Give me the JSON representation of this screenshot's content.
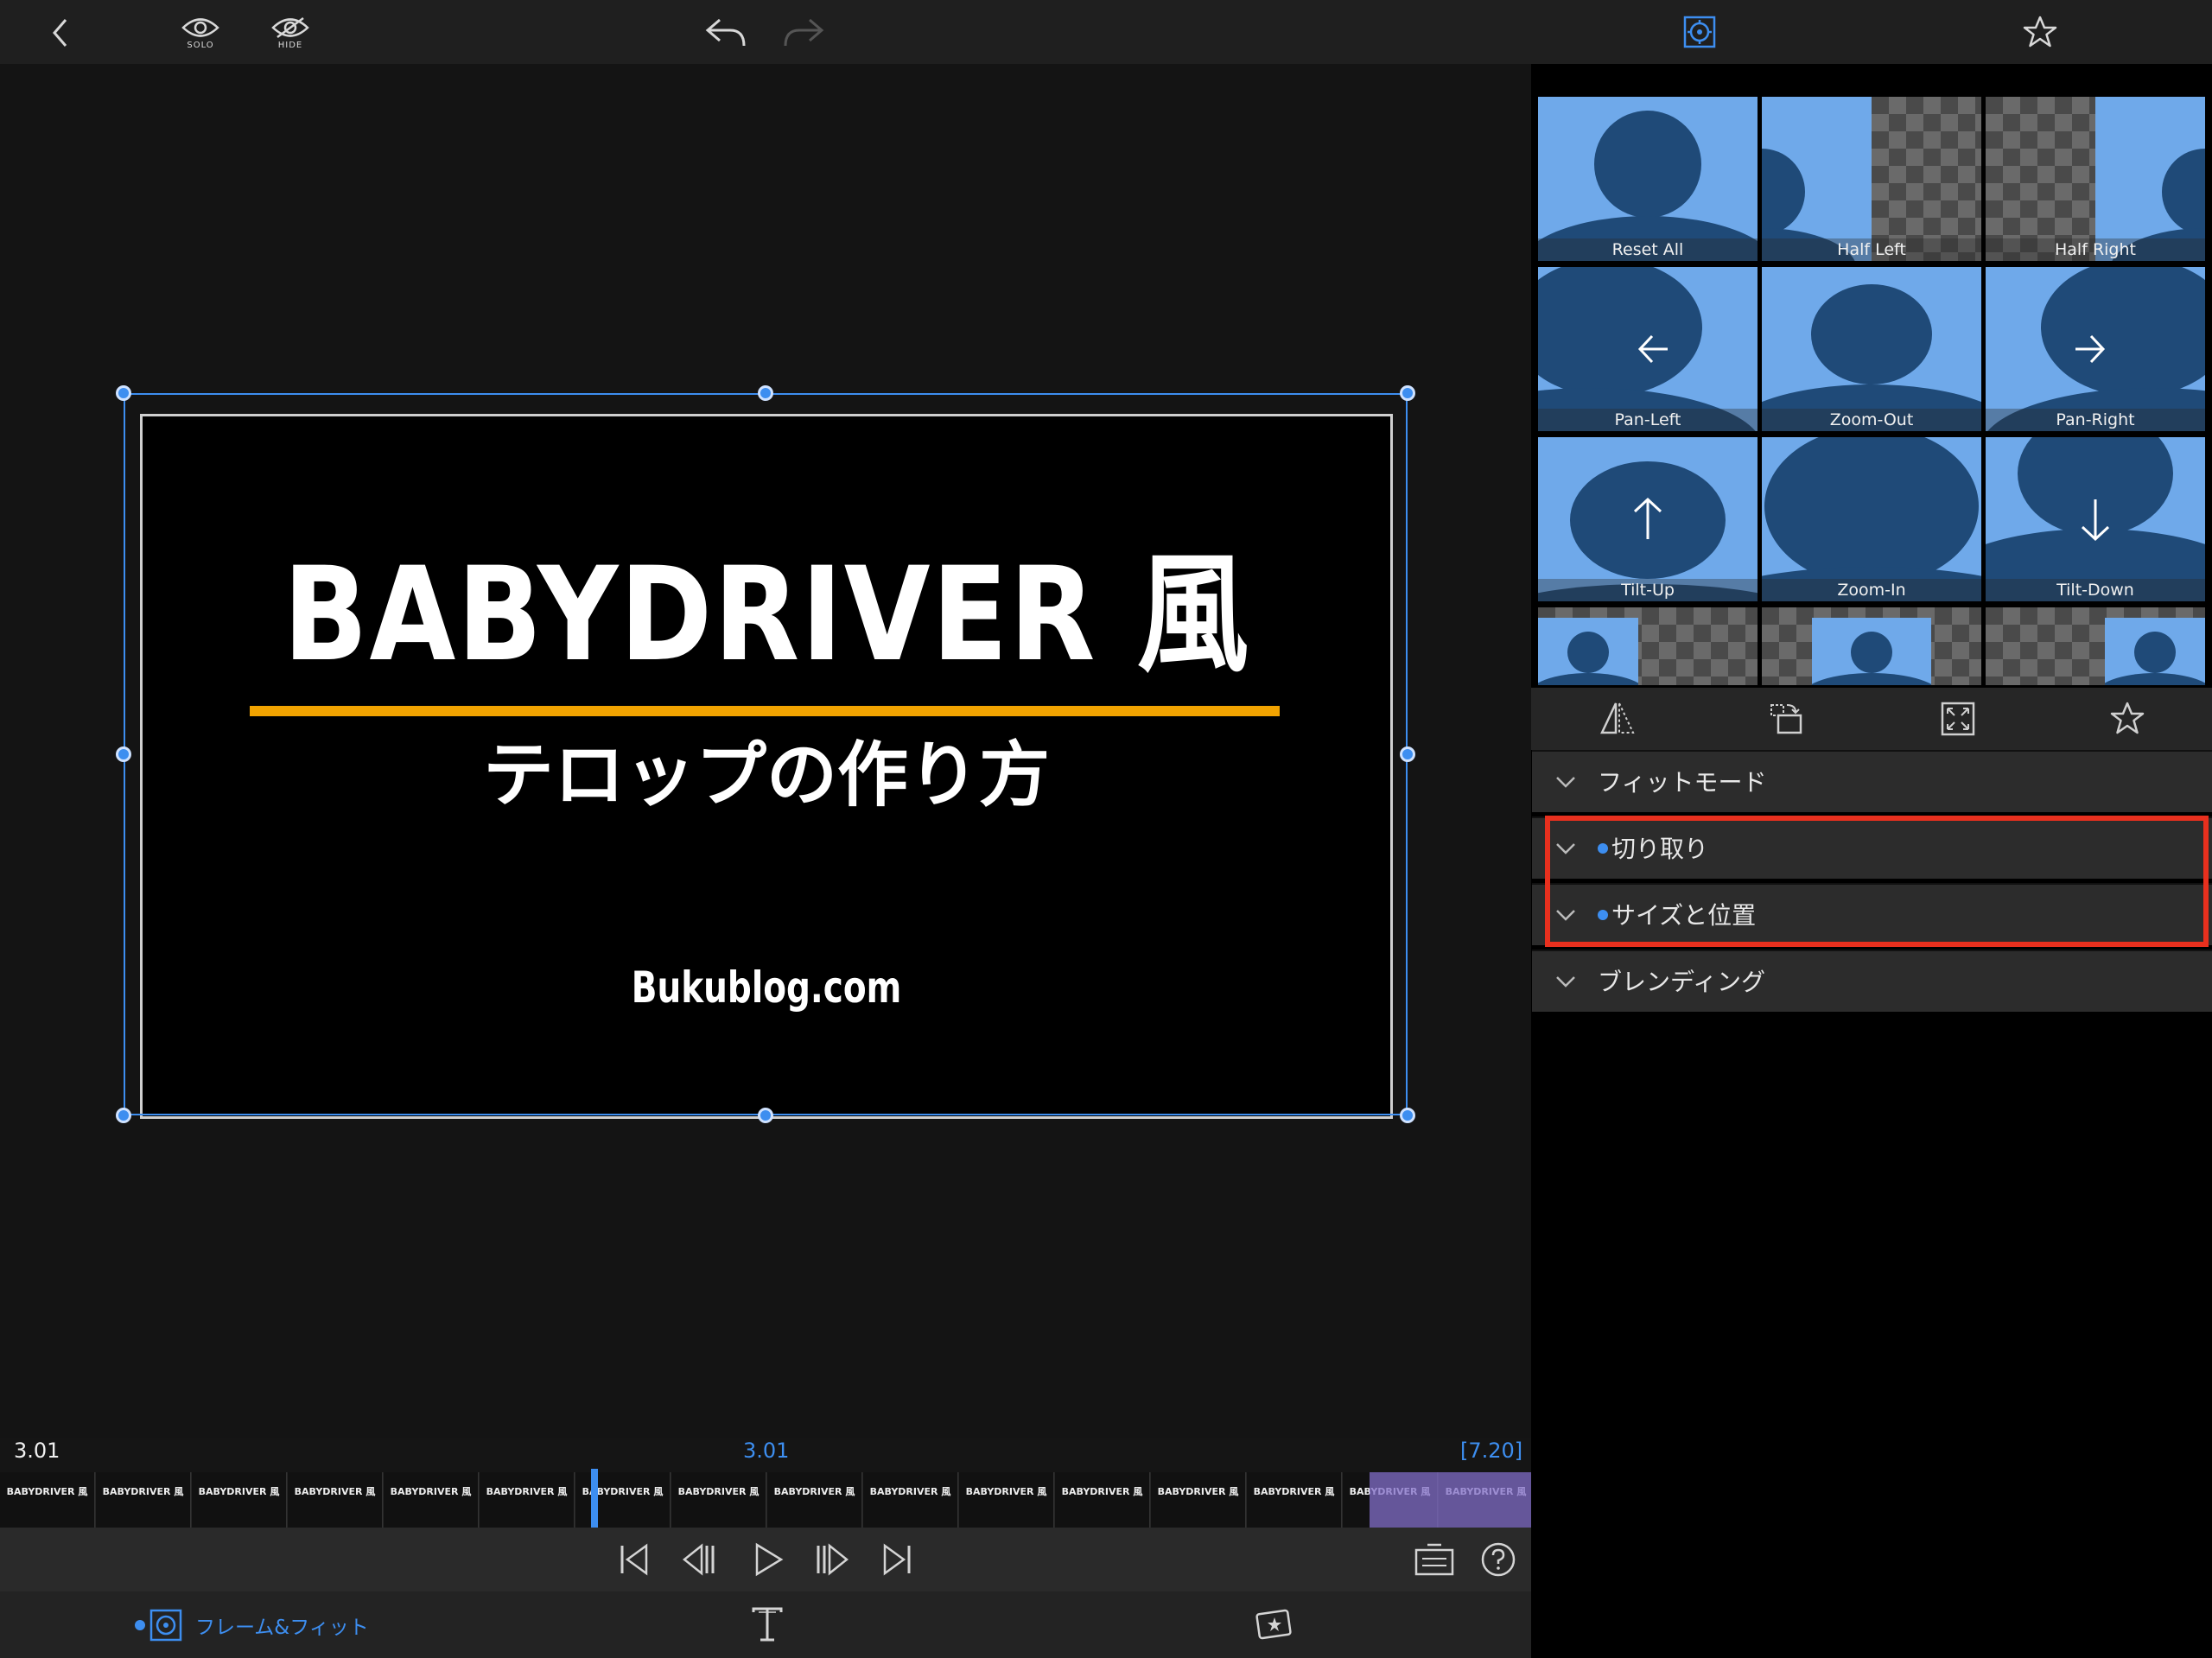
{
  "toolbar": {
    "solo_label": "SOLO",
    "hide_label": "HIDE"
  },
  "preview": {
    "title": "BABYDRIVER 風",
    "subtitle": "テロップの作り方",
    "site": "Bukublog.com"
  },
  "presets": [
    {
      "label": "Reset All"
    },
    {
      "label": "Half Left"
    },
    {
      "label": "Half Right"
    },
    {
      "label": "Pan-Left"
    },
    {
      "label": "Zoom-Out"
    },
    {
      "label": "Pan-Right"
    },
    {
      "label": "Tilt-Up"
    },
    {
      "label": "Zoom-In"
    },
    {
      "label": "Tilt-Down"
    }
  ],
  "sections": [
    {
      "label": "フィットモード",
      "modified": false
    },
    {
      "label": "切り取り",
      "modified": true
    },
    {
      "label": "サイズと位置",
      "modified": true
    },
    {
      "label": "ブレンディング",
      "modified": false
    }
  ],
  "timeline": {
    "current_left": "3.01",
    "current_center": "3.01",
    "duration": "[7.20]",
    "thumb_label": "BABYDRIVER 風"
  },
  "bottom_bar": {
    "frame_fit_label": "フレーム&フィット"
  },
  "colors": {
    "accent": "#3d8ef0",
    "highlight": "#e8301e",
    "underline": "#f2a300",
    "preset_bg": "#6fa9ea",
    "preset_silhouette": "#1f4a78"
  }
}
